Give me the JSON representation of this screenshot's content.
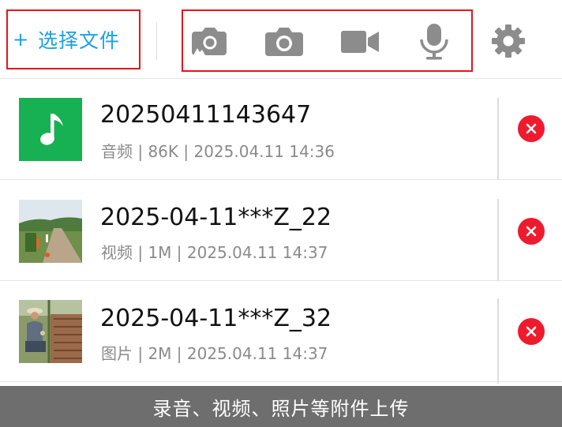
{
  "toolbar": {
    "plus_symbol": "+",
    "select_file_label": "选择文件",
    "icons": [
      "gallery-camera-icon",
      "camera-icon",
      "video-camera-icon",
      "microphone-icon",
      "gear-icon"
    ]
  },
  "colors": {
    "accent": "#1aa0e6",
    "highlight_border": "#e8141b",
    "icon_gray": "#8c8c8c",
    "delete_red": "#ee1b2e",
    "audio_thumb_green": "#17b053",
    "footer_bg": "#6e6e6e"
  },
  "files": [
    {
      "name": "20250411143647",
      "meta": "音频 | 86K | 2025.04.11 14:36",
      "kind": "audio"
    },
    {
      "name": "2025-04-11***Z_22",
      "meta": "视频 | 1M | 2025.04.11 14:37",
      "kind": "video"
    },
    {
      "name": "2025-04-11***Z_32",
      "meta": "图片 | 2M | 2025.04.11 14:37",
      "kind": "image"
    }
  ],
  "footer": {
    "caption": "录音、视频、照片等附件上传"
  }
}
